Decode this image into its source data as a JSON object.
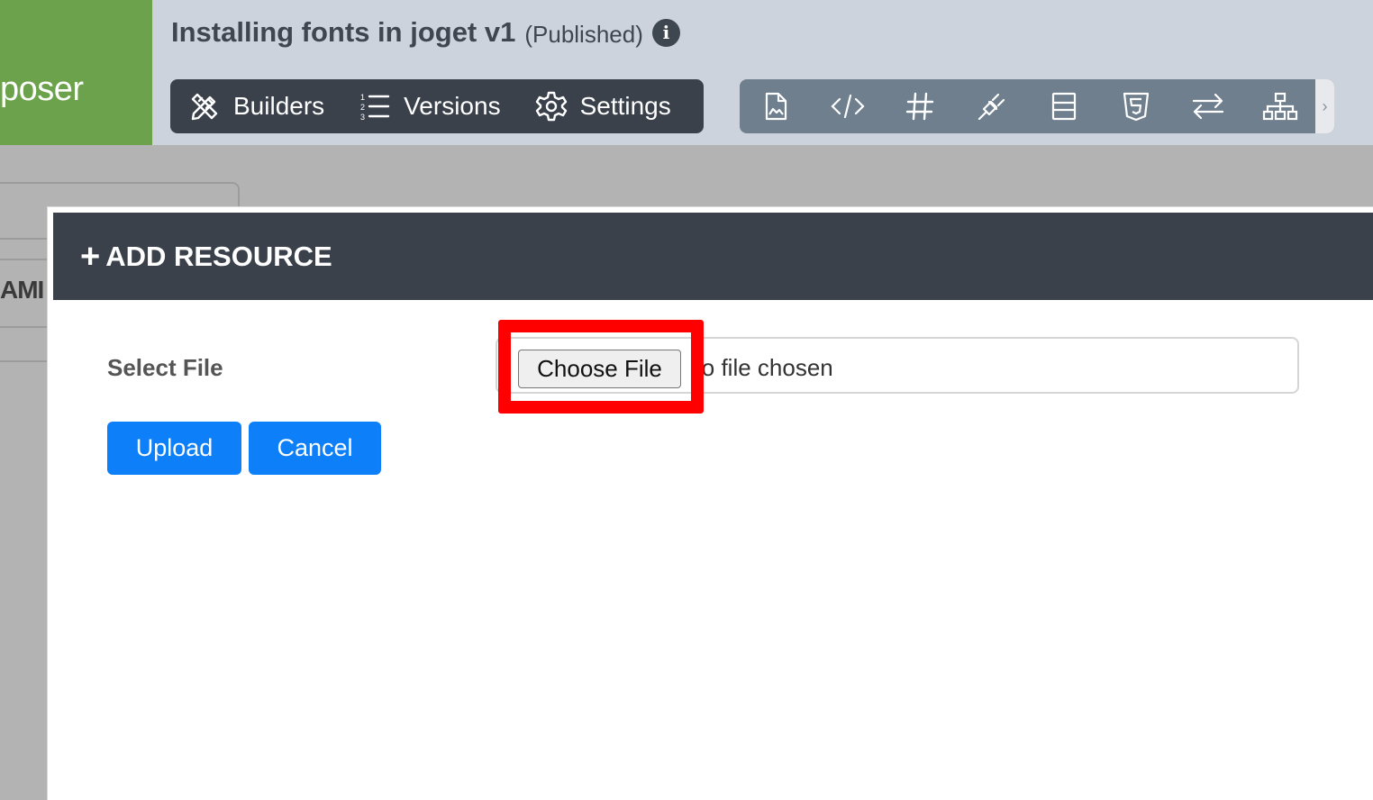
{
  "brand": {
    "label": "poser",
    "color": "#6ba24b"
  },
  "app": {
    "title": "Installing fonts in joget v1",
    "status": "(Published)",
    "info_icon": "info-circle-icon"
  },
  "nav": {
    "items": [
      {
        "label": "Builders",
        "icon": "pencil-ruler-icon"
      },
      {
        "label": "Versions",
        "icon": "numbered-list-icon"
      },
      {
        "label": "Settings",
        "icon": "gear-icon"
      }
    ]
  },
  "tools": [
    {
      "icon": "file-image-icon"
    },
    {
      "icon": "code-icon"
    },
    {
      "icon": "hashtag-icon"
    },
    {
      "icon": "plug-icon"
    },
    {
      "icon": "layout-rows-icon"
    },
    {
      "icon": "html5-icon"
    },
    {
      "icon": "exchange-arrows-icon"
    },
    {
      "icon": "sitemap-icon"
    }
  ],
  "tools_scroll": "›",
  "background": {
    "column_label": "AMI"
  },
  "modal": {
    "title": "ADD RESOURCE",
    "title_icon": "+",
    "field_label": "Select File",
    "choose_button": "Choose File",
    "file_status": "lo file chosen",
    "upload_label": "Upload",
    "cancel_label": "Cancel",
    "highlight_color": "#ff0000",
    "primary_color": "#0d7ff8"
  }
}
